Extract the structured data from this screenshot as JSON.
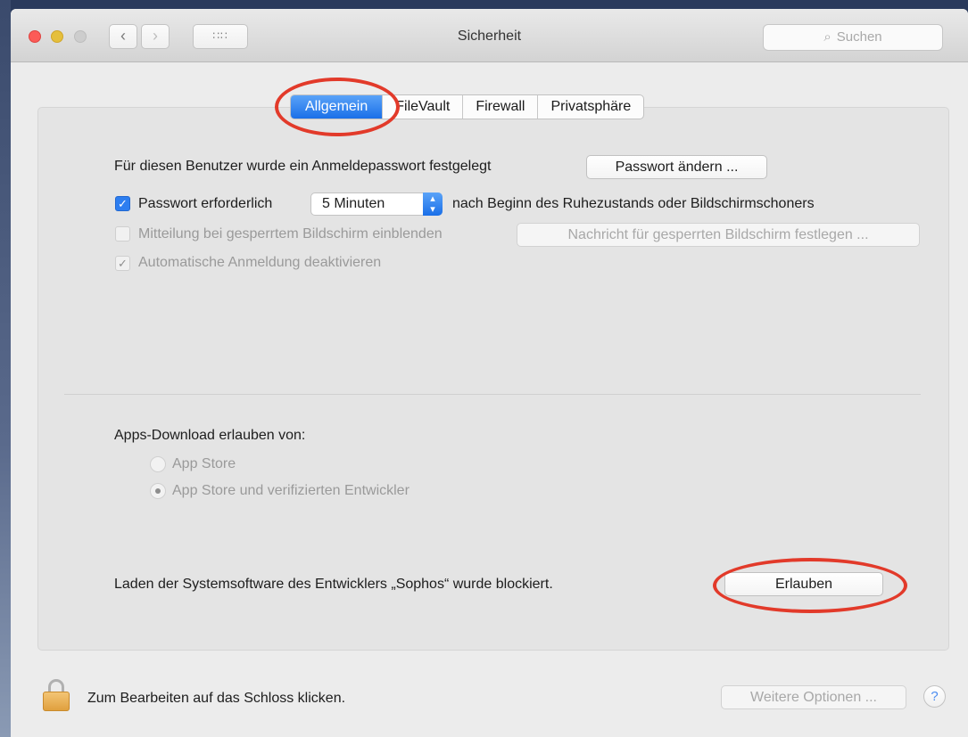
{
  "window": {
    "title": "Sicherheit",
    "search_placeholder": "Suchen",
    "grid_icon": "∷∷"
  },
  "tabs": [
    {
      "label": "Allgemein",
      "active": true
    },
    {
      "label": "FileVault",
      "active": false
    },
    {
      "label": "Firewall",
      "active": false
    },
    {
      "label": "Privatsphäre",
      "active": false
    }
  ],
  "general": {
    "password_set_label": "Für diesen Benutzer wurde ein Anmeldepasswort festgelegt",
    "change_password_button": "Passwort ändern ...",
    "require_password_label": "Passwort erforderlich",
    "require_password_checked": true,
    "require_password_delay": "5 Minuten",
    "require_password_suffix": "nach Beginn des Ruhezustands oder Bildschirmschoners",
    "show_message_label": "Mitteilung bei gesperrtem Bildschirm einblenden",
    "show_message_checked": false,
    "set_lock_message_button": "Nachricht für gesperrten Bildschirm festlegen ...",
    "disable_auto_login_label": "Automatische Anmeldung deaktivieren",
    "disable_auto_login_checked": true
  },
  "downloads": {
    "heading": "Apps-Download erlauben von:",
    "options": [
      {
        "label": "App Store",
        "selected": false
      },
      {
        "label": "App Store und verifizierten Entwickler",
        "selected": true
      }
    ],
    "blocked_message": "Laden der Systemsoftware des Entwicklers „Sophos“ wurde blockiert.",
    "allow_button": "Erlauben"
  },
  "footer": {
    "lock_message": "Zum Bearbeiten auf das Schloss klicken.",
    "advanced_button": "Weitere Optionen ...",
    "help_label": "?"
  },
  "colors": {
    "accent": "#2d7ef0",
    "highlight_ring": "#e23a2a"
  }
}
